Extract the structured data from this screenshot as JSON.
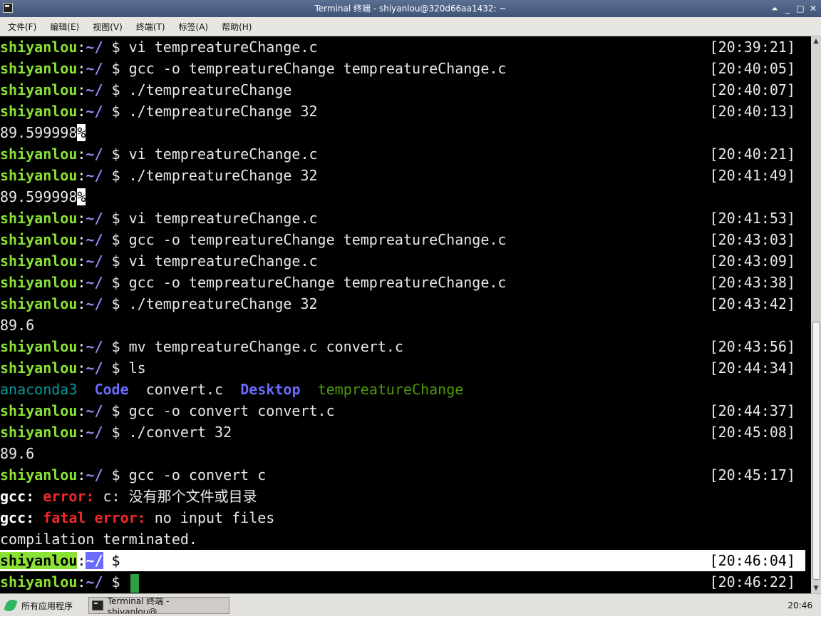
{
  "window": {
    "title": "Terminal 终端 - shiyanlou@320d66aa1432: ~",
    "controls": {
      "shade": "⏶",
      "minimize": "_",
      "maximize": "□",
      "close": "✕"
    }
  },
  "menu": [
    "文件(F)",
    "编辑(E)",
    "视图(V)",
    "终端(T)",
    "标签(A)",
    "帮助(H)"
  ],
  "prompt": {
    "user": "shiyanlou",
    "colon": ":",
    "path": "~/",
    "symbol": " $ "
  },
  "lines": [
    {
      "type": "cmd",
      "text": "vi tempreatureChange.c",
      "ts": "[20:39:21]"
    },
    {
      "type": "cmd",
      "text": "gcc -o tempreatureChange tempreatureChange.c",
      "ts": "[20:40:05]"
    },
    {
      "type": "cmd",
      "text": "./tempreatureChange",
      "ts": "[20:40:07]"
    },
    {
      "type": "cmd",
      "text": "./tempreatureChange 32",
      "ts": "[20:40:13]"
    },
    {
      "type": "out_pct",
      "text": "89.599998",
      "pct": "%"
    },
    {
      "type": "cmd",
      "text": "vi tempreatureChange.c",
      "ts": "[20:40:21]"
    },
    {
      "type": "cmd",
      "text": "./tempreatureChange 32",
      "ts": "[20:41:49]"
    },
    {
      "type": "out_pct",
      "text": "89.599998",
      "pct": "%"
    },
    {
      "type": "cmd",
      "text": "vi tempreatureChange.c",
      "ts": "[20:41:53]"
    },
    {
      "type": "cmd",
      "text": "gcc -o tempreatureChange tempreatureChange.c",
      "ts": "[20:43:03]"
    },
    {
      "type": "cmd",
      "text": "vi tempreatureChange.c",
      "ts": "[20:43:09]"
    },
    {
      "type": "cmd",
      "text": "gcc -o tempreatureChange tempreatureChange.c",
      "ts": "[20:43:38]"
    },
    {
      "type": "cmd",
      "text": "./tempreatureChange 32",
      "ts": "[20:43:42]"
    },
    {
      "type": "out",
      "text": "89.6"
    },
    {
      "type": "cmd",
      "text": "mv tempreatureChange.c convert.c",
      "ts": "[20:43:56]"
    },
    {
      "type": "cmd",
      "text": "ls",
      "ts": "[20:44:34]"
    },
    {
      "type": "ls",
      "items": [
        {
          "name": "anaconda3",
          "kind": "anaconda"
        },
        {
          "name": "Code",
          "kind": "dir"
        },
        {
          "name": "convert.c",
          "kind": "file"
        },
        {
          "name": "Desktop",
          "kind": "dir"
        },
        {
          "name": "tempreatureChange",
          "kind": "exec"
        }
      ]
    },
    {
      "type": "cmd",
      "text": "gcc -o convert convert.c",
      "ts": "[20:44:37]"
    },
    {
      "type": "cmd",
      "text": "./convert 32",
      "ts": "[20:45:08]"
    },
    {
      "type": "out",
      "text": "89.6"
    },
    {
      "type": "cmd",
      "text": "gcc -o convert c",
      "ts": "[20:45:17]"
    },
    {
      "type": "err",
      "prefix": "gcc:",
      "label": "error:",
      "rest": " c: 没有那个文件或目录"
    },
    {
      "type": "err",
      "prefix": "gcc:",
      "label": "fatal error:",
      "rest": " no input files"
    },
    {
      "type": "out",
      "text": "compilation terminated."
    },
    {
      "type": "cmd_hl",
      "text": "",
      "ts": "[20:46:04]"
    },
    {
      "type": "cmd_cursor",
      "text": "",
      "ts": "[20:46:22]"
    }
  ],
  "taskbar": {
    "start_label": "所有应用程序",
    "task_label": "Terminal 终端 - shiyanlou@…",
    "clock": "20:46"
  }
}
